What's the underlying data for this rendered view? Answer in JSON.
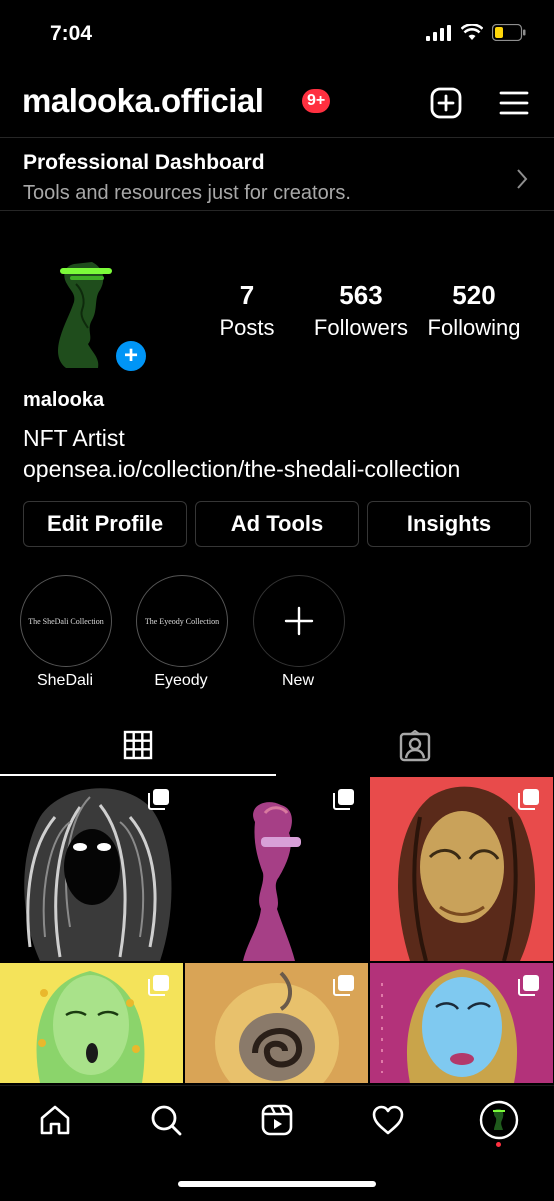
{
  "status_bar": {
    "time": "7:04"
  },
  "header": {
    "username": "malooka.official",
    "notification_badge": "9+"
  },
  "dashboard": {
    "title": "Professional Dashboard",
    "subtitle": "Tools and resources just for creators."
  },
  "profile": {
    "stats": [
      {
        "value": "7",
        "label": "Posts"
      },
      {
        "value": "563",
        "label": "Followers"
      },
      {
        "value": "520",
        "label": "Following"
      }
    ],
    "name": "malooka",
    "bio": "NFT Artist",
    "link": "opensea.io/collection/the-shedali-collection"
  },
  "buttons": {
    "edit_profile": "Edit Profile",
    "ad_tools": "Ad Tools",
    "insights": "Insights"
  },
  "highlights": [
    {
      "cover_text": "The SheDali Collection",
      "label": "SheDali"
    },
    {
      "cover_text": "The Eyeody Collection",
      "label": "Eyeody"
    },
    {
      "cover_text": "",
      "label": "New"
    }
  ],
  "colors": {
    "accent_blue": "#0095f6",
    "badge_red": "#ff3040",
    "battery_yellow": "#ffd60a"
  }
}
